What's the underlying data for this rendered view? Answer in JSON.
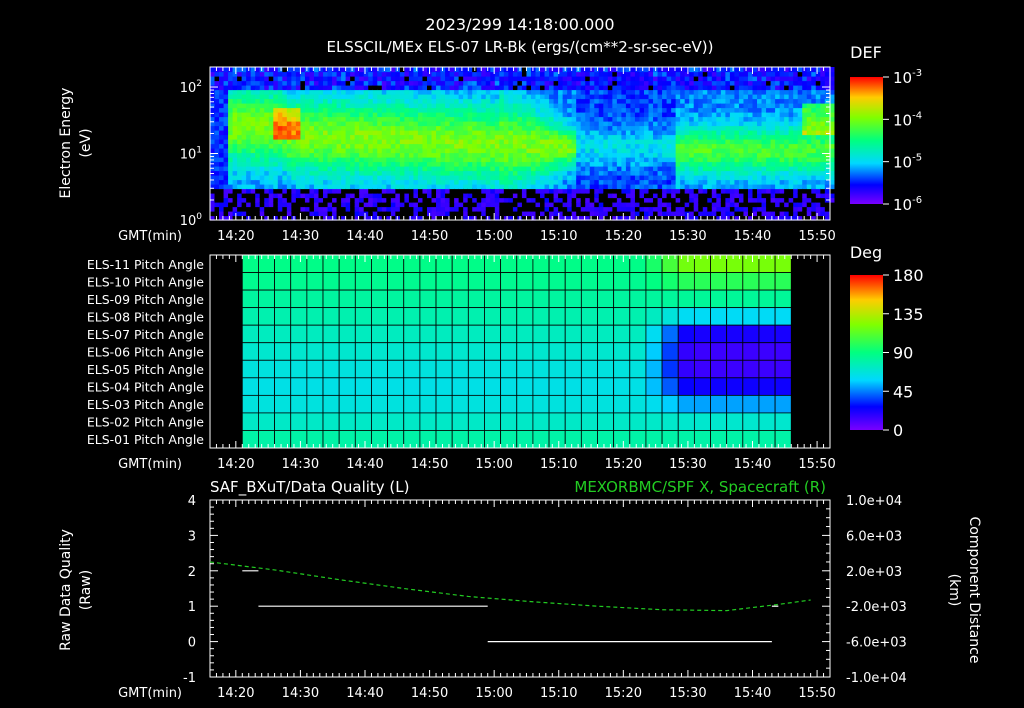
{
  "header": {
    "timestamp": "2023/299 14:18:00.000",
    "title": "ELSSCIL/MEx ELS-07 LR-Bk  (ergs/(cm**2-sr-sec-eV))"
  },
  "time_axis": {
    "label": "GMT(min)",
    "ticks": [
      "14:20",
      "14:30",
      "14:40",
      "14:50",
      "15:00",
      "15:10",
      "15:20",
      "15:30",
      "15:40",
      "15:50"
    ],
    "range_min": [
      0,
      96
    ]
  },
  "colors": {
    "background": "#000000",
    "axes": "#ffffff",
    "line_right": "#22cc22"
  },
  "chart_data": [
    {
      "type": "heatmap",
      "ylabel": "Electron Energy (eV)",
      "ylabel_line1": "Electron Energy",
      "ylabel_line2": "(eV)",
      "y_scale": "log",
      "ylim": [
        1,
        200
      ],
      "y_ticks": [
        "10^2",
        "10^1",
        "10^0"
      ],
      "colorbar": {
        "label": "DEF",
        "scale": "log",
        "ticks": [
          "10^-3",
          "10^-4",
          "10^-5",
          "10^-6"
        ],
        "colormap": "rainbow"
      },
      "features": [
        {
          "x_from": 5,
          "x_to": 57,
          "level": "high (yellow-green)"
        },
        {
          "x_from": 58,
          "x_to": 72,
          "level": "low (blue)"
        },
        {
          "x_from": 72,
          "x_to": 93,
          "level": "medium-high (green)"
        }
      ]
    },
    {
      "type": "heatmap",
      "ylabel": "",
      "row_labels": [
        "ELS-11 Pitch Angle",
        "ELS-10 Pitch Angle",
        "ELS-09 Pitch Angle",
        "ELS-08 Pitch Angle",
        "ELS-07 Pitch Angle",
        "ELS-06 Pitch Angle",
        "ELS-05 Pitch Angle",
        "ELS-04 Pitch Angle",
        "ELS-03 Pitch Angle",
        "ELS-02 Pitch Angle",
        "ELS-01 Pitch Angle"
      ],
      "row_values_start": [
        88,
        86,
        82,
        78,
        74,
        70,
        66,
        64,
        66,
        72,
        80
      ],
      "row_values_end": [
        120,
        100,
        84,
        60,
        22,
        14,
        14,
        24,
        50,
        70,
        80
      ],
      "data_x_range": [
        5,
        90
      ],
      "colorbar": {
        "label": "Deg",
        "ticks": [
          "180",
          "135",
          "90",
          "45",
          "0"
        ],
        "range": [
          0,
          180
        ],
        "colormap": "rainbow"
      }
    },
    {
      "type": "line",
      "title_left": "SAF_BXuT/Data Quality (L)",
      "title_right": "MEXORBMC/SPF X, Spacecraft (R)",
      "ylabel_left": "Raw Data Quality (Raw)",
      "ylabel_left_line1": "Raw Data Quality",
      "ylabel_left_line2": "(Raw)",
      "ylabel_right": "Component Distance (km)",
      "ylabel_right_line1": "Component Distance",
      "ylabel_right_line2": "(km)",
      "ylim_left": [
        -1,
        4
      ],
      "y_ticks_left": [
        "4",
        "3",
        "2",
        "1",
        "0",
        "-1"
      ],
      "ylim_right": [
        -10000,
        10000
      ],
      "y_ticks_right": [
        "1.0e+04",
        "6.0e+03",
        "2.0e+03",
        "-2.0e+03",
        "-6.0e+03",
        "-1.0e+04"
      ],
      "series": [
        {
          "axis": "left",
          "segments": [
            {
              "x": [
                5,
                7.5
              ],
              "y": 2
            },
            {
              "x": [
                7.5,
                43
              ],
              "y": 1
            },
            {
              "x": [
                43,
                87
              ],
              "y": 0
            },
            {
              "x": [
                87,
                88
              ],
              "y": 1
            }
          ]
        },
        {
          "axis": "right",
          "style": "dashed",
          "x": [
            0,
            10,
            20,
            30,
            40,
            50,
            60,
            70,
            80,
            88,
            93
          ],
          "y": [
            3000,
            2100,
            1000,
            0,
            -900,
            -1500,
            -2000,
            -2400,
            -2500,
            -1800,
            -1300
          ]
        }
      ]
    }
  ]
}
